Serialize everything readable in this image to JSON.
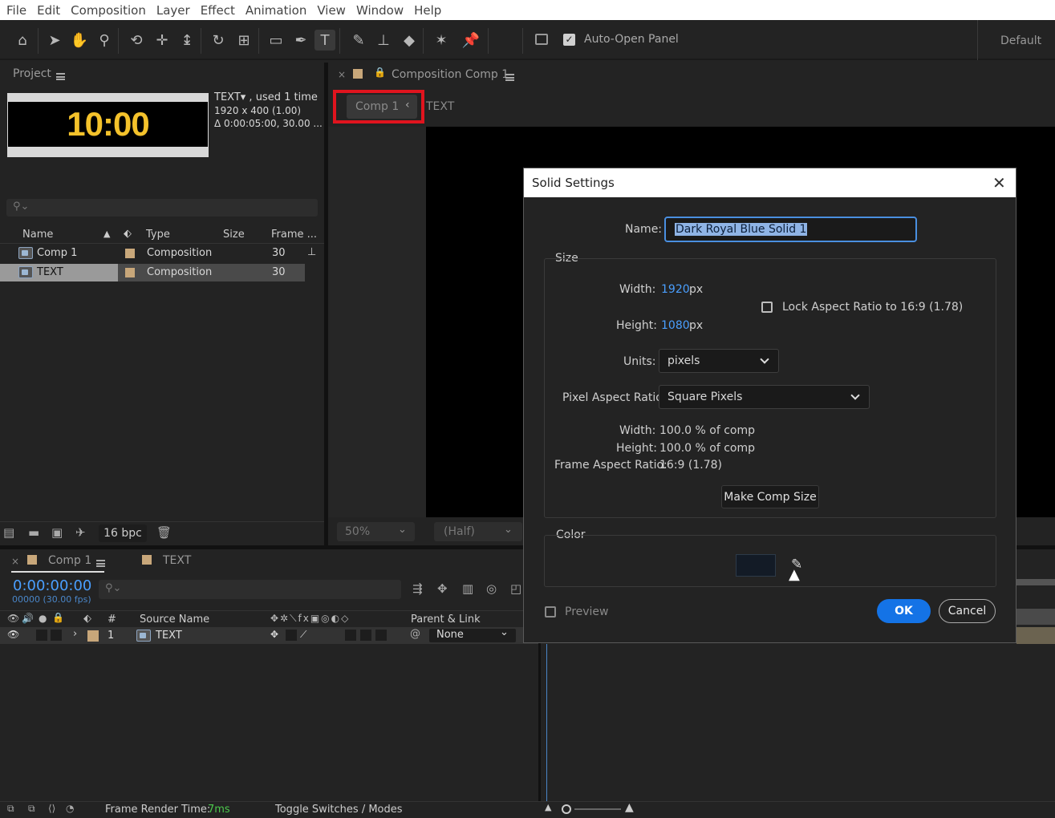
{
  "menu": [
    "File",
    "Edit",
    "Composition",
    "Layer",
    "Effect",
    "Animation",
    "View",
    "Window",
    "Help"
  ],
  "toolbar": {
    "auto_open_panel": "Auto-Open Panel",
    "workspace": "Default",
    "tools": [
      "home-icon",
      "selection-icon",
      "hand-icon",
      "zoom-icon",
      "orbit-icon",
      "pan-icon",
      "dolly-icon",
      "rotate-icon",
      "anchor-icon",
      "rectangle-icon",
      "pen-icon",
      "type-icon",
      "brush-icon",
      "clone-stamp-icon",
      "eraser-icon",
      "roto-brush-icon",
      "puppet-pin-icon"
    ]
  },
  "project": {
    "title": "Project",
    "thumb_text": "10:00",
    "info_line1": "TEXT▾ , used 1 time",
    "info_line2": "1920 x 400 (1.00)",
    "info_line3": "Δ 0:00:05:00, 30.00 ...",
    "columns": {
      "name": "Name",
      "type": "Type",
      "size": "Size",
      "frame": "Frame ..."
    },
    "items": [
      {
        "name": "Comp 1",
        "type": "Composition",
        "frame": "30"
      },
      {
        "name": "TEXT",
        "type": "Composition",
        "frame": "30"
      }
    ],
    "bpc": "16 bpc"
  },
  "composition": {
    "tab_title": "Composition Comp 1",
    "breadcrumb_active": "Comp 1",
    "breadcrumb_next": "TEXT",
    "zoom": "50%",
    "resolution": "(Half)"
  },
  "timeline": {
    "tab_comp": "Comp 1",
    "tab_text": "TEXT",
    "timecode": "0:00:00:00",
    "frames": "00000 (30.00 fps)",
    "columns": {
      "num": "#",
      "source": "Source Name",
      "parent": "Parent & Link"
    },
    "layer": {
      "num": "1",
      "name": "TEXT",
      "parent": "None"
    },
    "render_label": "Frame Render Time:",
    "render_value": "7ms",
    "toggle": "Toggle Switches / Modes"
  },
  "dialog": {
    "title": "Solid Settings",
    "name_label": "Name:",
    "name_value": "Dark Royal Blue Solid 1",
    "size_label": "Size",
    "width_label": "Width:",
    "width_value": "1920",
    "height_label": "Height:",
    "height_value": "1080",
    "px": "px",
    "lock_label": "Lock Aspect Ratio to 16:9 (1.78)",
    "units_label": "Units:",
    "units_value": "pixels",
    "par_label": "Pixel Aspect Ratio:",
    "par_value": "Square Pixels",
    "pct_width_label": "Width:",
    "pct_width_value": "100.0 % of comp",
    "pct_height_label": "Height:",
    "pct_height_value": "100.0 % of comp",
    "far_label": "Frame Aspect Ratio:",
    "far_value": "16:9 (1.78)",
    "make_comp_size": "Make Comp Size",
    "color_label": "Color",
    "preview_label": "Preview",
    "ok": "OK",
    "cancel": "Cancel",
    "color_swatch": "#131b26"
  },
  "colors": {
    "accent": "#1473e6",
    "highlight": "#e0141e",
    "timecode": "#4a9fff",
    "render_value": "#4cc94c",
    "label_swatch": "#c8a77a"
  }
}
